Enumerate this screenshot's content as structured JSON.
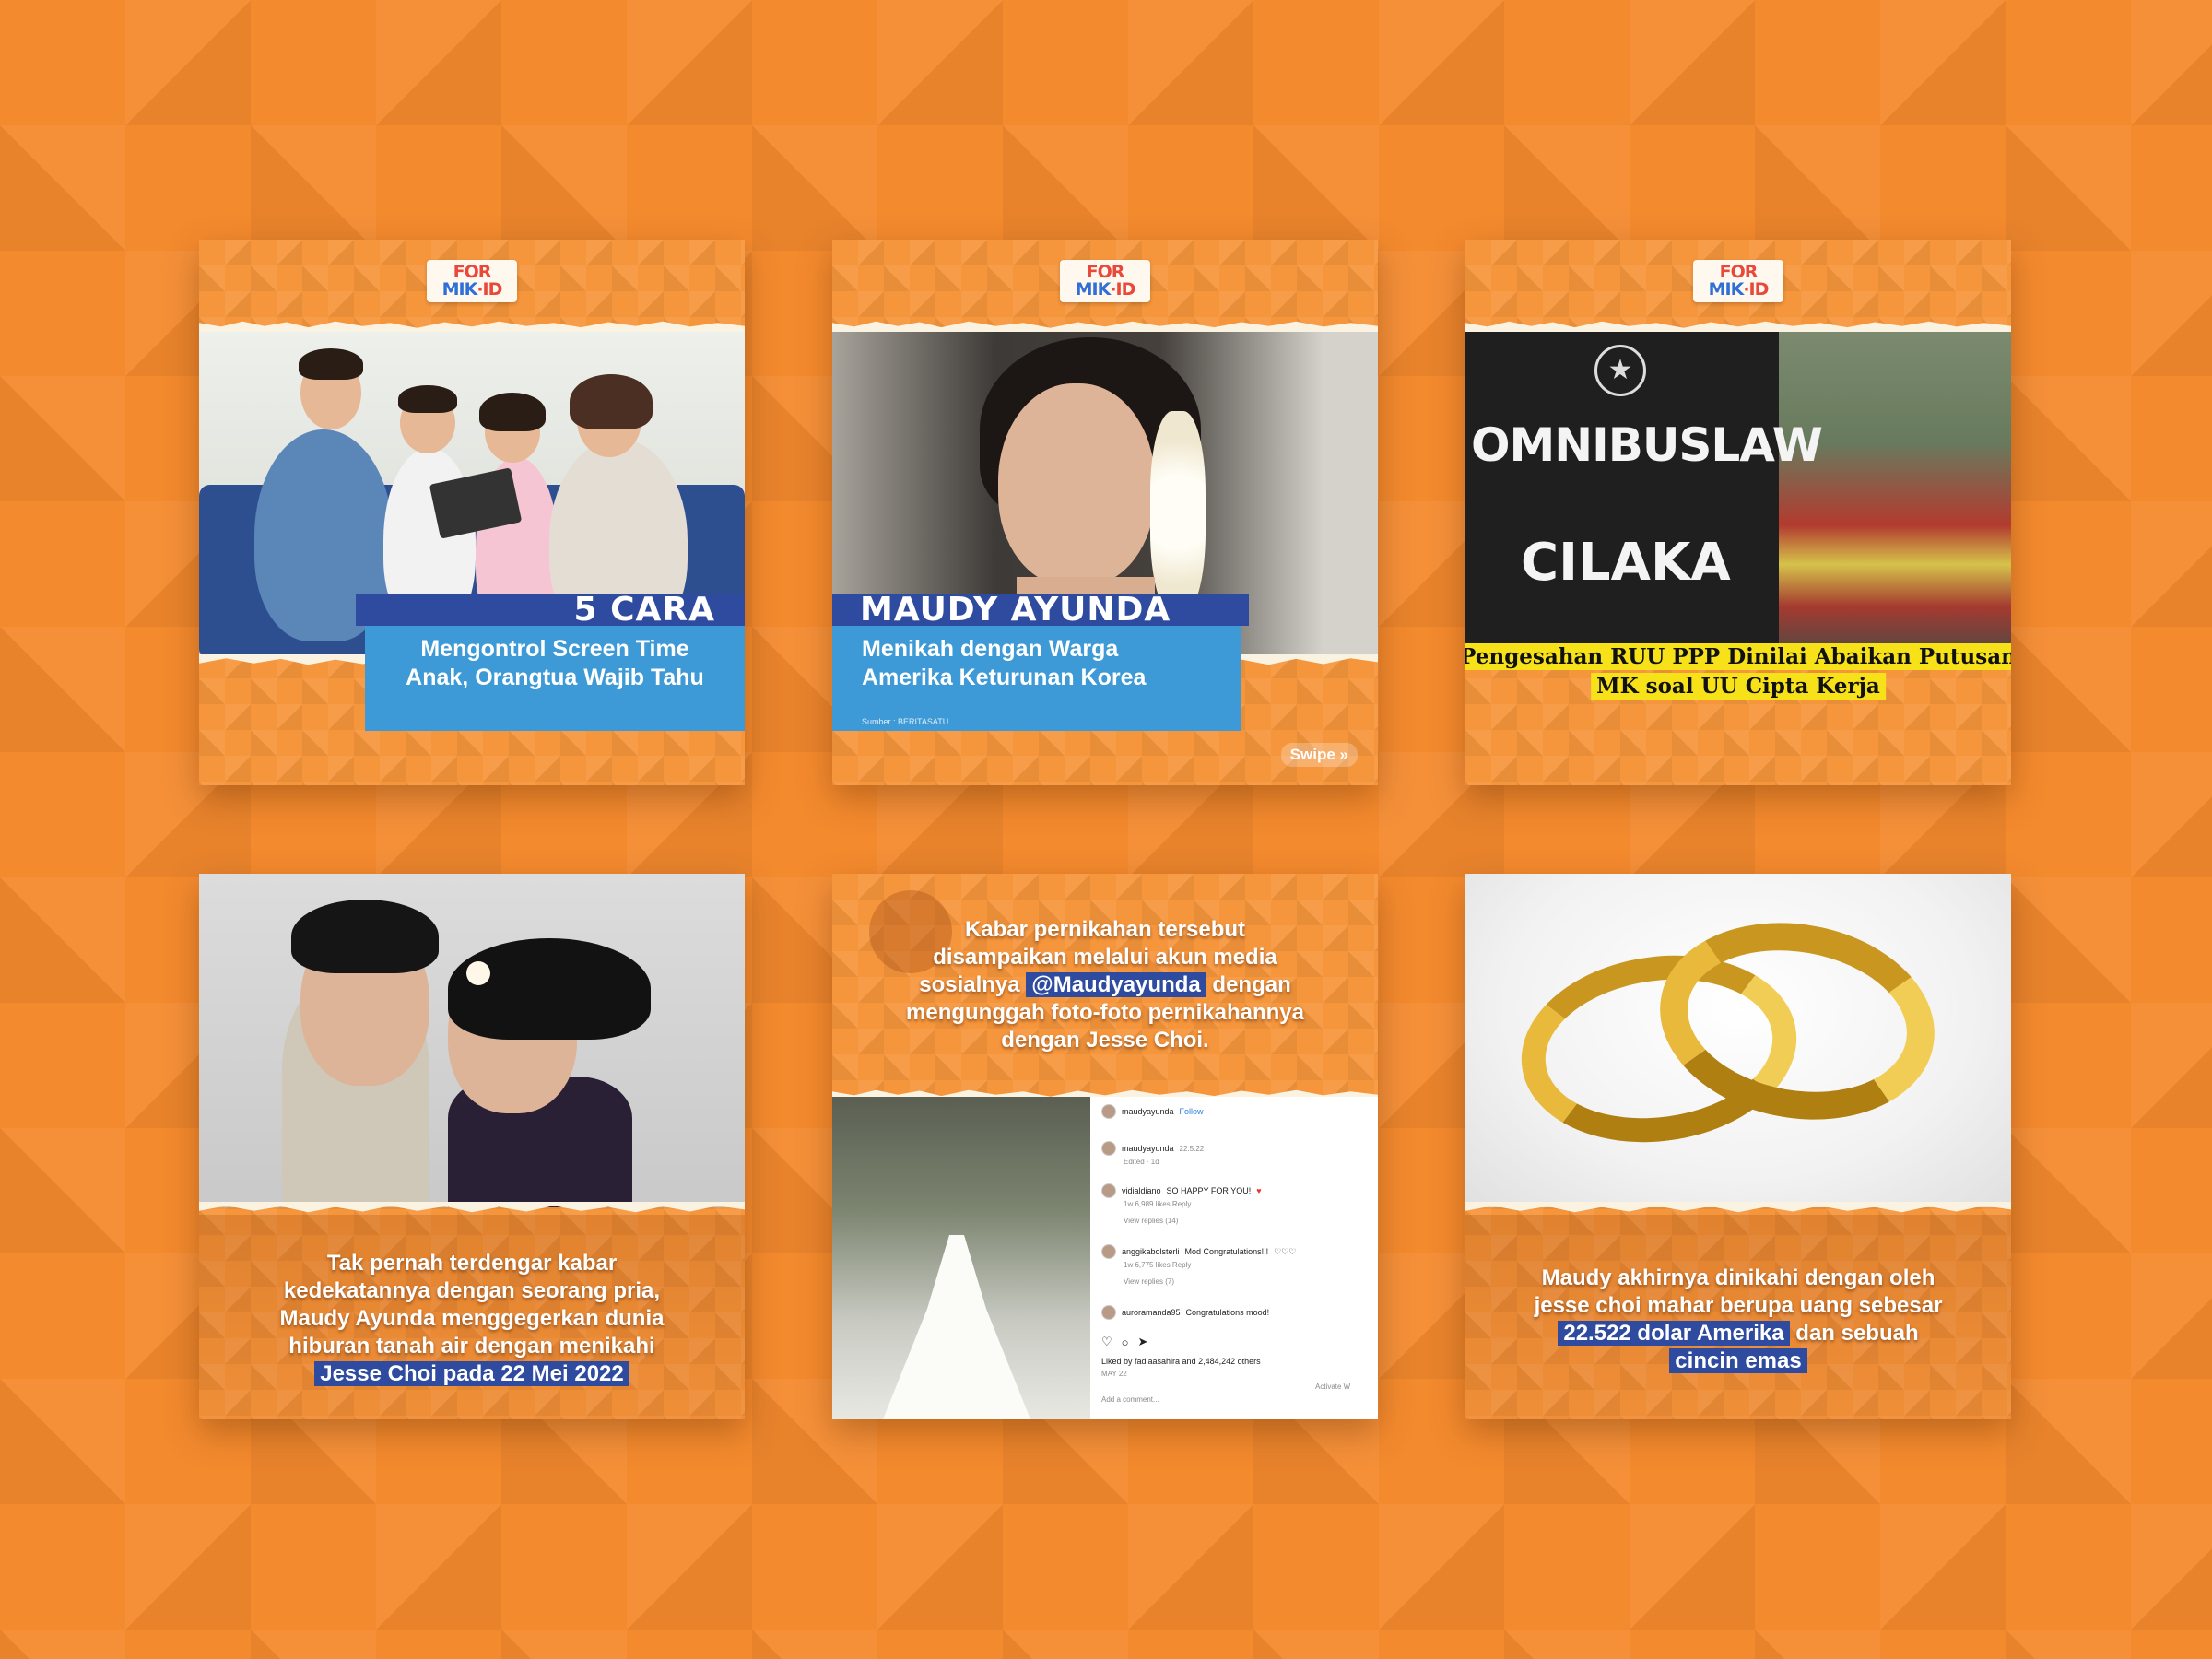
{
  "brand": {
    "logo_line1": "FOR",
    "logo_line2": "MIK",
    "logo_id": "·ID"
  },
  "card1": {
    "headline": "5 CARA",
    "subtitle_line1": "Mengontrol Screen Time",
    "subtitle_line2": "Anak, Orangtua Wajib Tahu"
  },
  "card2": {
    "headline": "MAUDY AYUNDA",
    "subtitle_line1": "Menikah dengan Warga",
    "subtitle_line2": "Amerika Keturunan Korea",
    "source": "Sumber : BERITASATU",
    "swipe": "Swipe"
  },
  "card3": {
    "sign_line1": "OMNIBUSLAW",
    "sign_line2": "CILAKA",
    "caption_line1": "Pengesahan RUU PPP Dinilai Abaikan Putusan",
    "caption_line2": "MK soal UU Cipta Kerja"
  },
  "card4": {
    "line1": "Tak pernah terdengar kabar",
    "line2": "kedekatannya dengan seorang pria,",
    "line3": "Maudy Ayunda menggegerkan dunia",
    "line4": "hiburan tanah air dengan menikahi",
    "highlight": "Jesse Choi pada 22 Mei 2022"
  },
  "card5": {
    "line1": "Kabar pernikahan tersebut",
    "line2": "disampaikan melalui akun media",
    "line3_pre": "sosialnya ",
    "line3_hl": "@Maudyayunda",
    "line3_post": " dengan",
    "line4": "mengunggah foto-foto pernikahannya",
    "line5": "dengan Jesse Choi.",
    "ig": {
      "username": "maudyayunda",
      "follow": "Follow",
      "post_date": "22.5.22",
      "edited": "Edited · 1d",
      "c1_user": "vidialdiano",
      "c1_text": "SO HAPPY FOR YOU!",
      "c1_meta": "1w   6,989 likes   Reply",
      "c1_replies": "View replies (14)",
      "c2_user": "anggikabolsterli",
      "c2_text": "Mod Congratulations!!!",
      "c2_meta": "1w   6,775 likes   Reply",
      "c2_replies": "View replies (7)",
      "c3_user": "auroramanda95",
      "c3_text": "Congratulations mood!",
      "liked_by": "Liked by fadiaasahira and 2,484,242 others",
      "date": "MAY 22",
      "add_comment": "Add a comment...",
      "activate": "Activate W"
    }
  },
  "card6": {
    "line1": "Maudy akhirnya dinikahi dengan oleh",
    "line2": "jesse choi mahar berupa uang sebesar",
    "line3_hl": "22.522 dolar Amerika",
    "line3_post": " dan sebuah",
    "line4_hl": "cincin emas"
  },
  "colors": {
    "background_orange": "#f48a2e",
    "headline_blue": "#2f4ba0",
    "subtitle_blue": "#3d9ad6",
    "caption_yellow": "#f7e21a"
  }
}
